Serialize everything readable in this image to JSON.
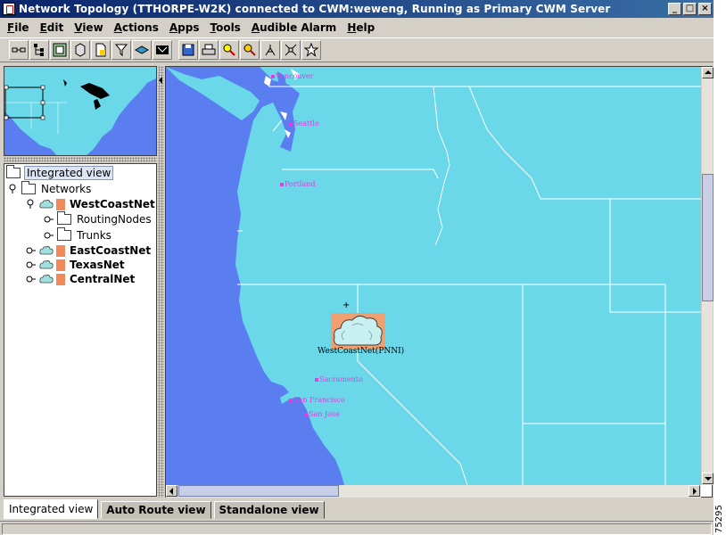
{
  "window": {
    "title": "Network Topology  (TTHORPE-W2K) connected to CWM:weweng, Running as Primary CWM Server",
    "minimize": "_",
    "maximize": "□",
    "close": "×"
  },
  "menubar": [
    "File",
    "Edit",
    "View",
    "Actions",
    "Apps",
    "Tools",
    "Audible Alarm",
    "Help"
  ],
  "toolbar_icons": [
    "link-icon",
    "tree-icon",
    "network-icon",
    "box-icon",
    "document-icon",
    "filter-icon",
    "layers-icon",
    "mail-icon",
    "save-icon",
    "print-icon",
    "zoom-in-icon",
    "zoom-out-icon",
    "hierarchy-icon",
    "fit-icon",
    "star-icon"
  ],
  "tree": {
    "root": "Integrated view",
    "networks": "Networks",
    "westcoast": "WestCoastNet",
    "routing_nodes": "RoutingNodes",
    "trunks": "Trunks",
    "eastcoast": "EastCoastNet",
    "texas": "TexasNet",
    "central": "CentralNet"
  },
  "map": {
    "cities": {
      "vancouver": "Vancouver",
      "seattle": "Seattle",
      "portland": "Portland",
      "sacramento": "Sacramento",
      "san_francisco": "San Francisco",
      "san_jose": "San Jose"
    },
    "network_node_label": "WestCoastNet(PNNI)",
    "node_marker": "+"
  },
  "colors": {
    "ocean": "#5a7ef0",
    "land": "#6ad8e8",
    "city_label": "#e040e0",
    "node_background": "#f0a070"
  },
  "tabs": [
    "Integrated view",
    "Auto Route view",
    "Standalone view"
  ],
  "active_tab": "Integrated view",
  "figure_number": "75295"
}
